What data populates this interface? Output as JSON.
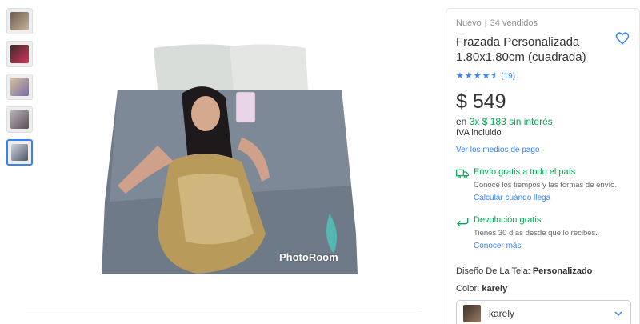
{
  "thumbnails": [
    {
      "name": "thumb-1",
      "colors": [
        "#6b5a50",
        "#c9b49a"
      ]
    },
    {
      "name": "thumb-2",
      "colors": [
        "#d6345a",
        "#3a2a2a"
      ]
    },
    {
      "name": "thumb-3",
      "colors": [
        "#d6c49a",
        "#7a6aa8"
      ]
    },
    {
      "name": "thumb-4",
      "colors": [
        "#b8b2bb",
        "#5a4f55"
      ]
    },
    {
      "name": "thumb-5",
      "colors": [
        "#cfd3da",
        "#4b5666"
      ],
      "selected": true
    }
  ],
  "watermark": "PhotoRoom",
  "product": {
    "condition": "Nuevo",
    "sold": "34 vendidos",
    "title": "Frazada Personalizada 1.80x1.80cm (cuadrada)",
    "rating": 4.5,
    "rating_count": "(19)",
    "price": "$ 549",
    "installments_prefix": "en",
    "installments_highlight": "3x $ 183 sin interés",
    "iva": "IVA incluido",
    "payment_link": "Ver los medios de pago"
  },
  "shipping": {
    "title": "Envío gratis a todo el país",
    "subtitle": "Conoce los tiempos y las formas de envío.",
    "link": "Calcular cuándo llega"
  },
  "returns": {
    "title": "Devolución gratis",
    "subtitle": "Tienes 30 días desde que lo recibes.",
    "link": "Conocer más"
  },
  "specs": {
    "fabric_label": "Diseño De La Tela:",
    "fabric_value": "Personalizado",
    "color_label": "Color:",
    "color_value": "karely"
  },
  "color_select": {
    "selected": "karely"
  },
  "colors": {
    "accent": "#3483fa",
    "green": "#00a650"
  }
}
